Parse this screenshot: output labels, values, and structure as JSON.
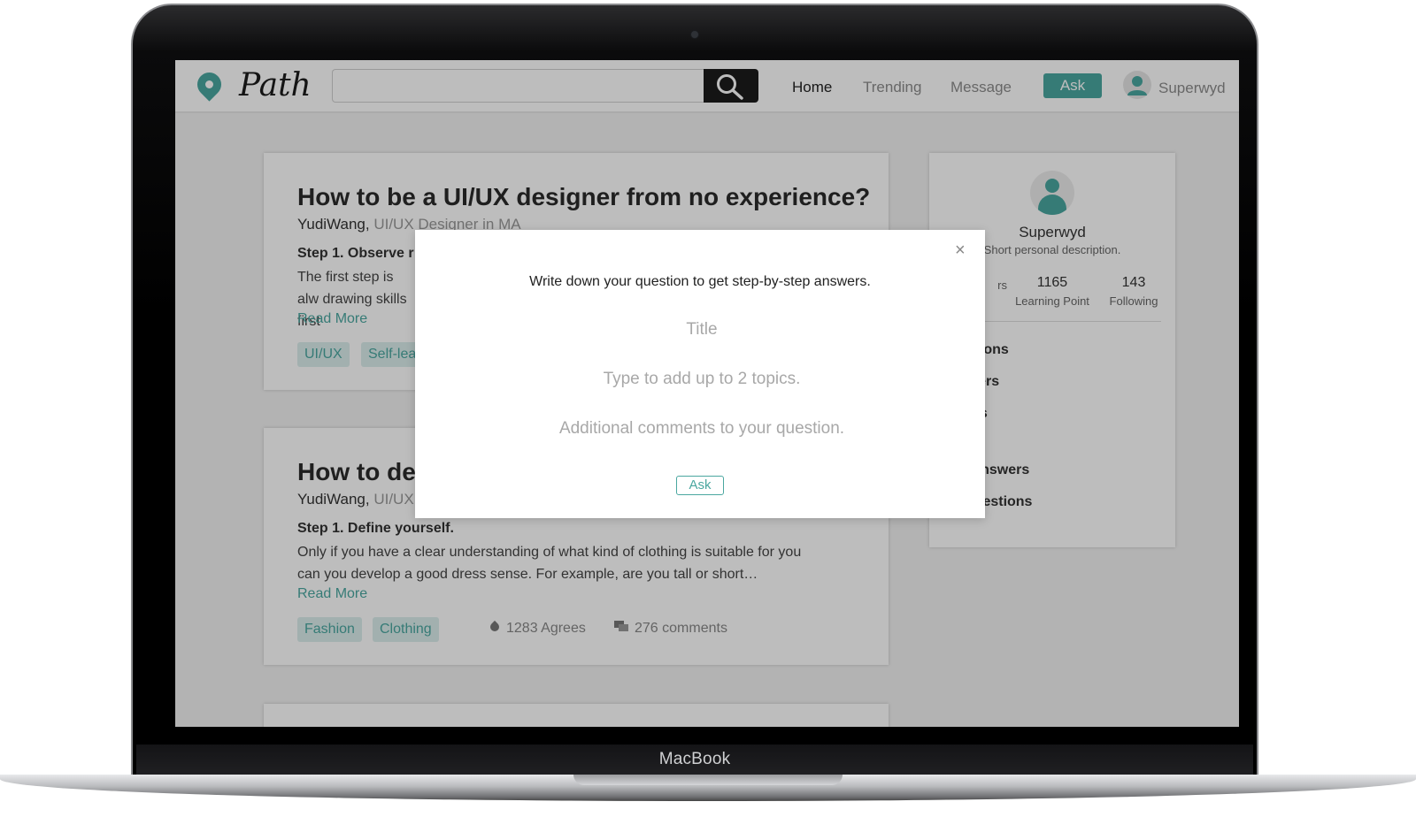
{
  "device": {
    "label": "MacBook"
  },
  "header": {
    "logo_text": "Path",
    "search_placeholder": "",
    "nav": {
      "home": "Home",
      "trending": "Trending",
      "message": "Message"
    },
    "ask_label": "Ask",
    "user_name": "Superwyd"
  },
  "feed": [
    {
      "title": "How to be a UI/UX designer from no experience?",
      "author": "YudiWang,",
      "role": "UI/UX Designer in MA",
      "step": "Step 1. Observe r",
      "body": "The first step is alw drawing skills first",
      "read_more": "Read More",
      "tags": [
        "UI/UX",
        "Self-lea"
      ]
    },
    {
      "title": "How to dev",
      "author": "YudiWang,",
      "role": "UI/UX",
      "step": "Step 1. Define yourself.",
      "body": "Only if you have a clear understanding of what kind of clothing is suitable for you can you develop a good dress sense. For example, are you tall or short…",
      "read_more": "Read More",
      "tags": [
        "Fashion",
        "Clothing"
      ],
      "agrees": "1283 Agrees",
      "comments": "276 comments"
    }
  ],
  "profile": {
    "name": "Superwyd",
    "description": "Short personal description.",
    "stats": [
      {
        "value": "",
        "label": "rs"
      },
      {
        "value": "1165",
        "label": "Learning Point"
      },
      {
        "value": "143",
        "label": "Following"
      }
    ],
    "links": [
      "uestions",
      "nswers",
      "opics",
      "ed Answers",
      "d Questions"
    ]
  },
  "modal": {
    "heading": "Write down your question to get step-by-step answers.",
    "title_placeholder": "Title",
    "topics_placeholder": "Type to add up to 2 topics.",
    "comments_placeholder": "Additional comments to your question.",
    "ask_label": "Ask",
    "close_glyph": "×"
  },
  "colors": {
    "accent": "#4aa7a0",
    "overlay": "rgba(0,0,0,0.26)"
  }
}
